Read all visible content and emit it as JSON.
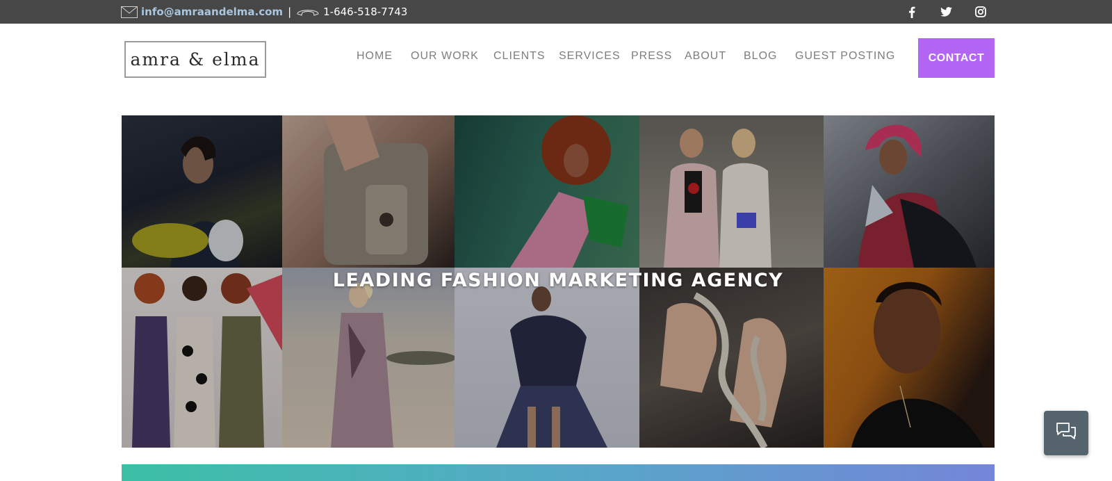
{
  "topbar": {
    "email": "info@amraandelma.com",
    "separator": "|",
    "phone": "1-646-518-7743",
    "icons": [
      "mail-icon",
      "phone-icon",
      "facebook-icon",
      "twitter-icon",
      "instagram-icon"
    ]
  },
  "header": {
    "logo_text": "amra & elma",
    "nav": [
      "HOME",
      "OUR WORK",
      "CLIENTS",
      "SERVICES",
      "PRESS",
      "ABOUT",
      "BLOG",
      "GUEST POSTING"
    ],
    "contact_label": "CONTACT"
  },
  "hero": {
    "title": "LEADING FASHION MARKETING AGENCY"
  },
  "colors": {
    "topbar": "#474747",
    "contact_button": "#b366f4",
    "email_link": "#a8c6e0",
    "nav_text": "#7d7d7d",
    "chat_widget": "#56656d"
  },
  "chat": {
    "icon": "chat-bubbles-icon"
  }
}
